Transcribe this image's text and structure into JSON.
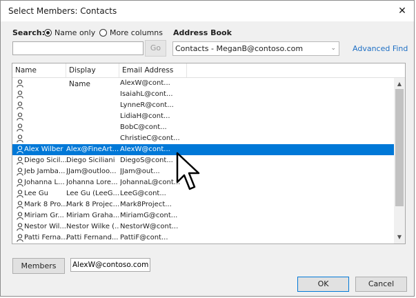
{
  "window": {
    "title": "Select Members: Contacts",
    "background_caption": "Email"
  },
  "search": {
    "label": "Search:",
    "options": [
      {
        "label": "Name only",
        "selected": true
      },
      {
        "label": "More columns",
        "selected": false
      }
    ],
    "input_value": "",
    "go_label": "Go"
  },
  "address_book": {
    "label": "Address Book",
    "selected": "Contacts - MeganB@contoso.com",
    "advanced_find": "Advanced Find"
  },
  "list": {
    "columns": [
      "Name",
      "Display Name",
      "Email Address"
    ],
    "selected_index": 6,
    "rows": [
      {
        "name": "",
        "display": "",
        "email": "AlexW@cont..."
      },
      {
        "name": "",
        "display": "",
        "email": "IsaiahL@cont..."
      },
      {
        "name": "",
        "display": "",
        "email": "LynneR@cont..."
      },
      {
        "name": "",
        "display": "",
        "email": "LidiaH@cont..."
      },
      {
        "name": "",
        "display": "",
        "email": "BobC@cont..."
      },
      {
        "name": "",
        "display": "",
        "email": "ChristieC@cont..."
      },
      {
        "name": "Alex Wilber",
        "display": "Alex@FineArt...",
        "email": "AlexW@cont..."
      },
      {
        "name": "Diego Sicil...",
        "display": "Diego Siciliani",
        "email": "DiegoS@cont..."
      },
      {
        "name": "Jeb Jamba...",
        "display": "JJam@outloo...",
        "email": "JJam@out..."
      },
      {
        "name": "Johanna L...",
        "display": "Johanna Lore...",
        "email": "JohannaL@cont..."
      },
      {
        "name": "Lee Gu",
        "display": "Lee Gu (LeeG...",
        "email": "LeeG@cont..."
      },
      {
        "name": "Mark 8 Pro...",
        "display": "Mark 8 Projec...",
        "email": "Mark8Project..."
      },
      {
        "name": "Miriam Gr...",
        "display": "Miriam Graha...",
        "email": "MiriamG@cont..."
      },
      {
        "name": "Nestor Wil...",
        "display": "Nestor Wilke (...",
        "email": "NestorW@cont..."
      },
      {
        "name": "Patti Ferna...",
        "display": "Patti Fernand...",
        "email": "PattiF@cont..."
      }
    ]
  },
  "members": {
    "button_label": "Members",
    "value": "AlexW@contoso.com"
  },
  "buttons": {
    "ok": "OK",
    "cancel": "Cancel"
  },
  "colors": {
    "selection": "#0078d7",
    "link": "#1e6fc4"
  },
  "icons": {
    "close": "close-icon",
    "contact": "person-icon",
    "cursor": "mouse-pointer-icon"
  }
}
